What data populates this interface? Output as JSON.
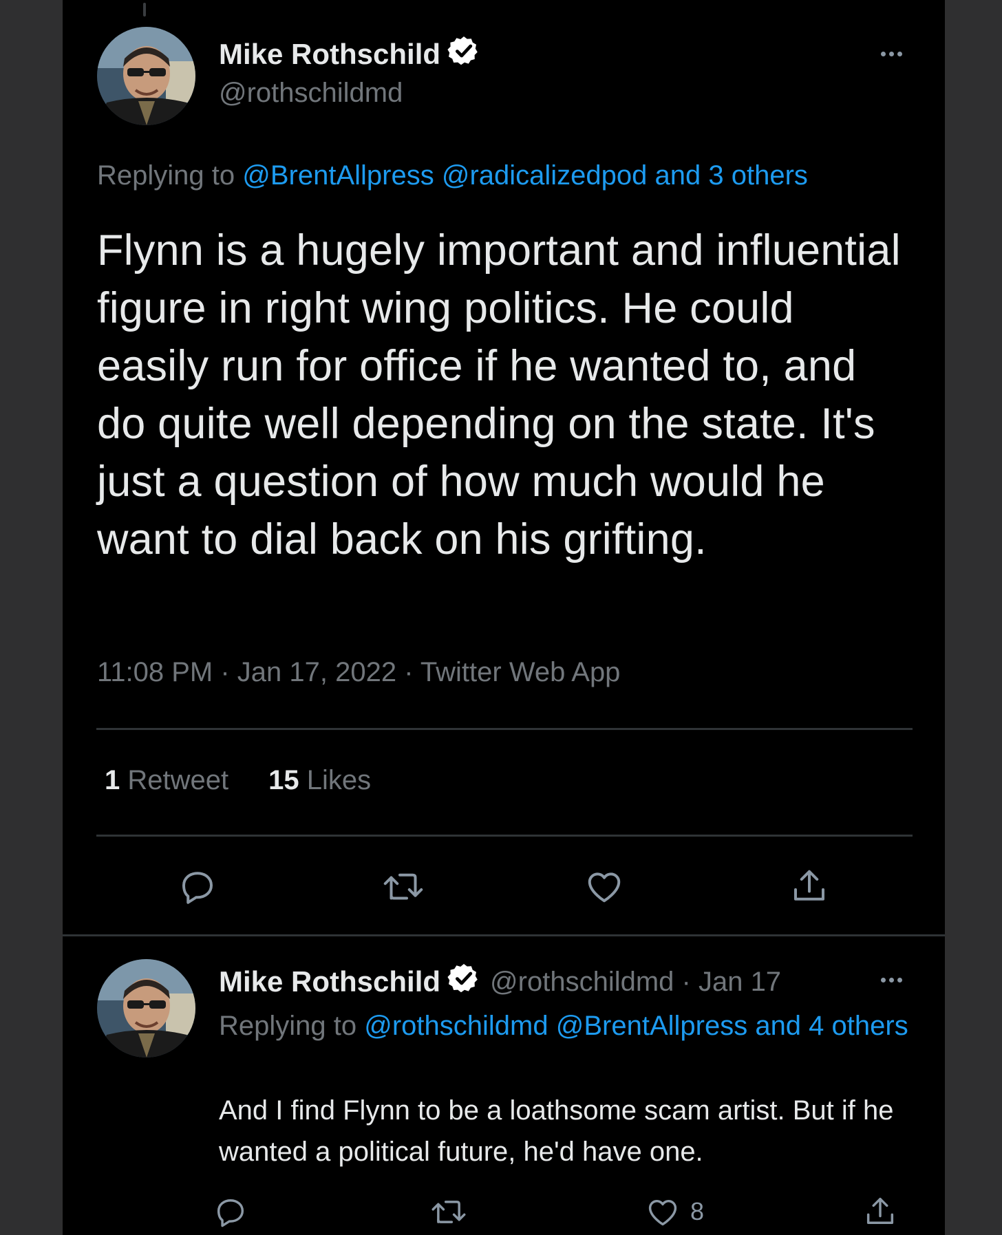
{
  "colors": {
    "background": "#000000",
    "text": "#e7e9ea",
    "muted": "#71767b",
    "link": "#1d9bf0",
    "divider": "#2f3336",
    "verified": "#ffffff"
  },
  "main_tweet": {
    "author": {
      "display_name": "Mike Rothschild",
      "handle": "@rothschildmd",
      "verified_icon": "verified-badge-icon",
      "avatar_icon": "avatar"
    },
    "replying_prefix": "Replying to",
    "replying_links": "@BrentAllpress @radicalizedpod and 3 others",
    "text": "Flynn is a hugely important and influential figure in right wing politics. He could easily run for office if he wanted to, and do quite well depending on the state. It's just a question of how much would he want to dial back on his grifting.",
    "timestamp": "11:08 PM · Jan 17, 2022 · Twitter Web App",
    "stats": {
      "retweet_count": "1",
      "retweet_label": "Retweet",
      "like_count": "15",
      "like_label": "Likes"
    },
    "actions": [
      "reply-icon",
      "retweet-icon",
      "like-icon",
      "share-icon"
    ]
  },
  "reply_tweet": {
    "author": {
      "display_name": "Mike Rothschild",
      "handle_date": "@rothschildmd · Jan 17",
      "verified_icon": "verified-badge-icon"
    },
    "replying_prefix": "Replying to",
    "replying_links": "@rothschildmd @BrentAllpress and 4 others",
    "text": "And I find Flynn to be a loathsome scam artist. But if he wanted a political future, he'd have one.",
    "like_count": "8",
    "actions": [
      "reply-icon",
      "retweet-icon",
      "like-icon",
      "share-icon"
    ]
  }
}
